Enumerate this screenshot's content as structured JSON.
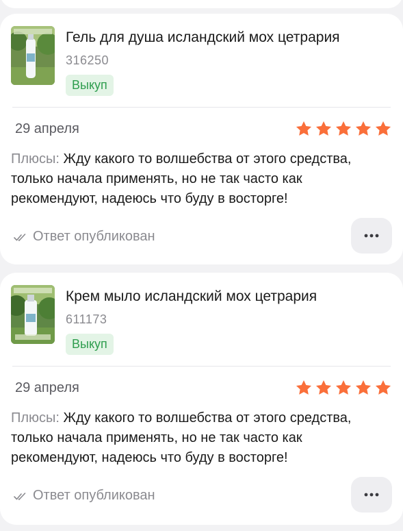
{
  "reviews": [
    {
      "product": {
        "title": "Гель для душа исландский мох цетрария",
        "code": "316250",
        "badge": "Выкуп",
        "image_label": "product-photo-shower-gel"
      },
      "date": "29 апреля",
      "rating": 5,
      "pros_label": "Плюсы:",
      "text": "Жду какого то волшебства от этого средства, только начала применять, но не так часто как рекомендуют, надеюсь что буду в восторге!",
      "status": "Ответ опубликован",
      "more_label": "…"
    },
    {
      "product": {
        "title": "Крем мыло исландский мох цетрария",
        "code": "611173",
        "badge": "Выкуп",
        "image_label": "product-photo-cream-soap"
      },
      "date": "29 апреля",
      "rating": 5,
      "pros_label": "Плюсы:",
      "text": "Жду какого то волшебства от этого средства, только начала применять, но не так часто как рекомендуют, надеюсь что буду в восторге!",
      "status": "Ответ опубликован",
      "more_label": "…"
    }
  ],
  "colors": {
    "star": "#fa6f3a",
    "badge_text": "#2e9d4e",
    "badge_bg": "#e3f4e6",
    "muted": "#8a8a8f"
  },
  "icons": {
    "star": "star-icon",
    "check": "double-check-icon",
    "more": "more-dots-icon"
  }
}
